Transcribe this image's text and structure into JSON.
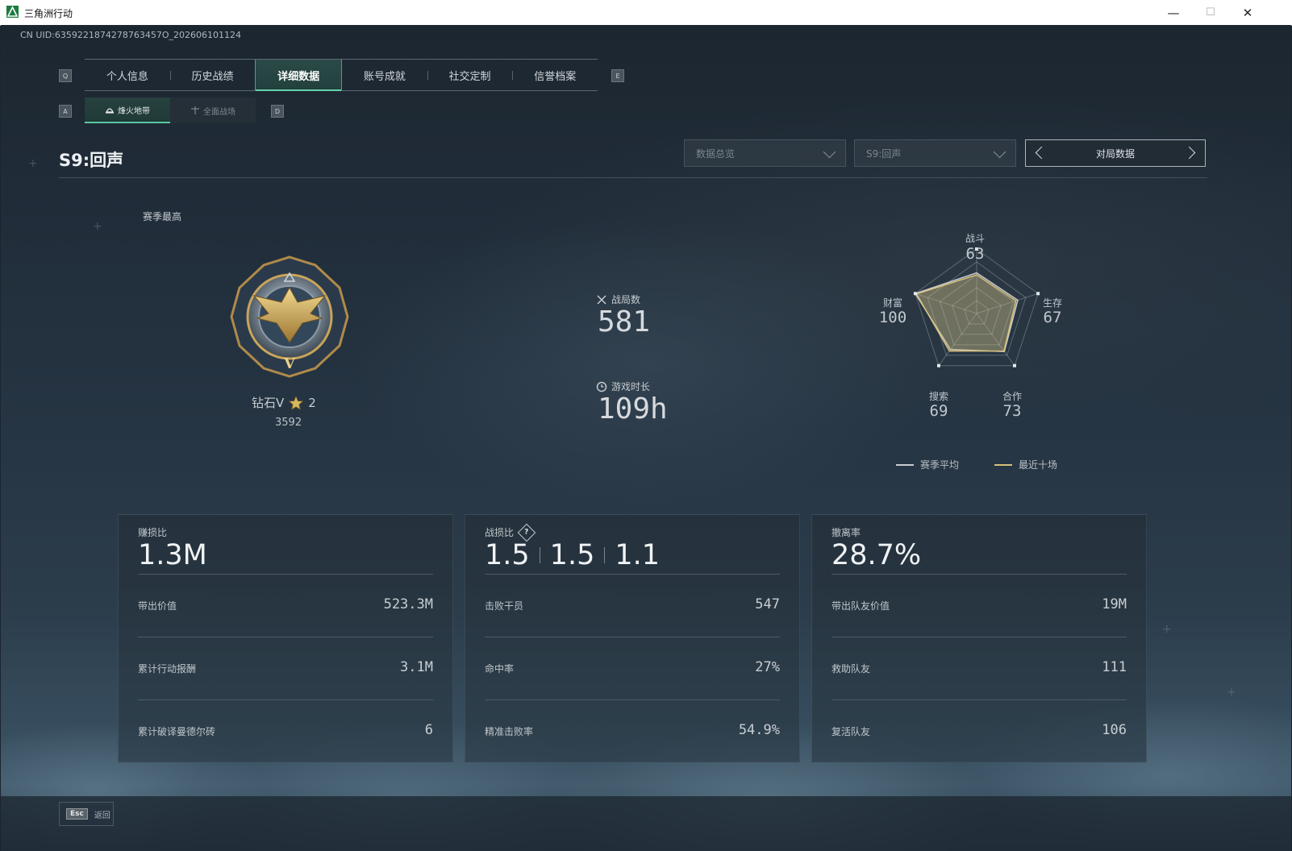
{
  "window": {
    "title": "三角洲行动",
    "minimize_glyph": "—",
    "maximize_glyph": "☐",
    "close_glyph": "✕"
  },
  "uid_text": "CN UID:6359221874278763457O_202606101124",
  "tabs": {
    "left_key": "Q",
    "right_key": "E",
    "items": [
      {
        "label": "个人信息"
      },
      {
        "label": "历史战绩"
      },
      {
        "label": "详细数据",
        "active": true
      },
      {
        "label": "账号成就"
      },
      {
        "label": "社交定制"
      },
      {
        "label": "信誉档案"
      }
    ]
  },
  "sub_tabs": {
    "left_key": "A",
    "right_key": "D",
    "items": [
      {
        "label": "烽火地带",
        "active": true,
        "icon": "fire-zone-icon"
      },
      {
        "label": "全面战场",
        "active": false,
        "icon": "battlefield-icon"
      }
    ]
  },
  "season": {
    "title": "S9:回声"
  },
  "filters": {
    "overview": "数据总览",
    "season": "S9:回声",
    "match_switch": "对局数据"
  },
  "rank": {
    "section_label": "赛季最高",
    "name": "钻石V",
    "stars": "2",
    "score": "3592",
    "medal_icon": "diamond-eagle-medal-icon"
  },
  "summary": {
    "matches_label": "战局数",
    "matches_value": "581",
    "playtime_label": "游戏时长",
    "playtime_value": "109h"
  },
  "radar": {
    "axes": [
      {
        "label": "战斗",
        "value": "63"
      },
      {
        "label": "生存",
        "value": "67"
      },
      {
        "label": "合作",
        "value": "73"
      },
      {
        "label": "搜索",
        "value": "69"
      },
      {
        "label": "财富",
        "value": "100"
      }
    ],
    "season_avg": [
      0.63,
      0.67,
      0.73,
      0.69,
      1.0
    ],
    "recent_ten": [
      0.6,
      0.64,
      0.72,
      0.72,
      0.98
    ],
    "legend": [
      {
        "label": "赛季平均",
        "color": "#c8cdd1"
      },
      {
        "label": "最近十场",
        "color": "#d6c07a"
      }
    ]
  },
  "cards": [
    {
      "title": "赚损比",
      "main": "1.3M",
      "rows": [
        {
          "label": "带出价值",
          "value": "523.3M"
        },
        {
          "label": "累计行动报酬",
          "value": "3.1M"
        },
        {
          "label": "累计破译曼德尔砖",
          "value": "6"
        }
      ]
    },
    {
      "title": "战损比",
      "main_parts": [
        "1.5",
        "1.5",
        "1.1"
      ],
      "rows": [
        {
          "label": "击败干员",
          "value": "547"
        },
        {
          "label": "命中率",
          "value": "27%"
        },
        {
          "label": "精准击败率",
          "value": "54.9%"
        }
      ]
    },
    {
      "title": "撤离率",
      "main": "28.7%",
      "rows": [
        {
          "label": "带出队友价值",
          "value": "19M"
        },
        {
          "label": "救助队友",
          "value": "111"
        },
        {
          "label": "复活队友",
          "value": "106"
        }
      ]
    }
  ],
  "bottom": {
    "esc_key": "Esc",
    "back_label": "返回"
  },
  "colors": {
    "accent": "#62d3ab",
    "gold": "#d6c07a"
  }
}
